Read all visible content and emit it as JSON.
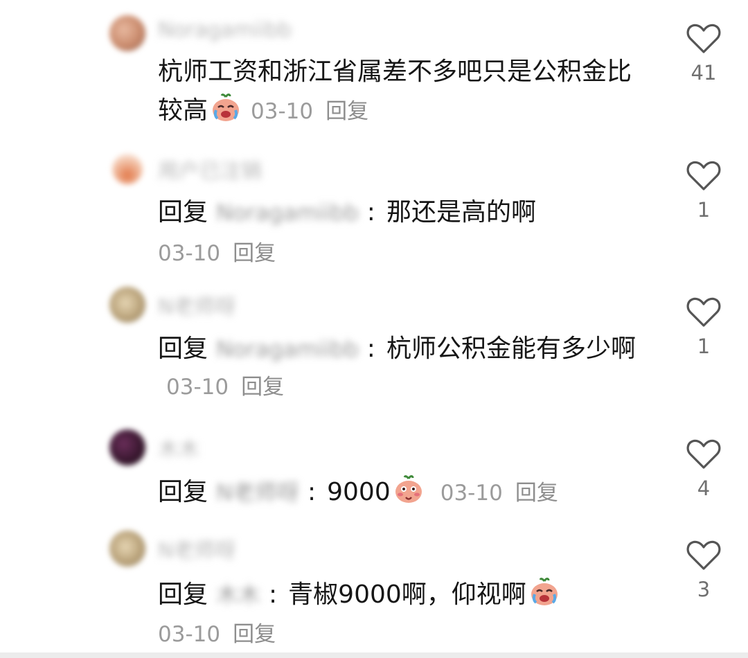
{
  "comments": [
    {
      "username": "Noragamiibb",
      "avatar_color": "#c98a6c",
      "text": "杭师工资和浙江省属差不多吧只是公积金比较高",
      "emoji": "crying-emoji",
      "date": "03-10",
      "reply_label": "回复",
      "likes": "41"
    },
    {
      "username": "用户已注销",
      "avatar_color": "#d9845c",
      "reply_prefix": "回复",
      "mention": "Noragamiibb",
      "text": "那还是高的啊",
      "date": "03-10",
      "reply_label": "回复",
      "likes": "1"
    },
    {
      "username": "N老师呀",
      "avatar_color": "#b9a27a",
      "reply_prefix": "回复",
      "mention": "Noragamiibb",
      "text": "杭师公积金能有多少啊",
      "date": "03-10",
      "reply_label": "回复",
      "likes": "1"
    },
    {
      "username": "木木",
      "avatar_color": "#3a1830",
      "reply_prefix": "回复",
      "mention": "N老师呀",
      "text": "9000",
      "emoji": "shy-emoji",
      "date": "03-10",
      "reply_label": "回复",
      "likes": "4"
    },
    {
      "username": "N老师呀",
      "avatar_color": "#b9a27a",
      "reply_prefix": "回复",
      "mention": "木木",
      "text": "青椒9000啊，仰视啊",
      "emoji": "crying-emoji",
      "date": "03-10",
      "reply_label": "回复",
      "likes": "3"
    }
  ],
  "icons": {
    "like": "heart-outline-icon"
  },
  "colors": {
    "text": "#161616",
    "meta": "#9b9b9b",
    "like_count": "#707070",
    "heart_stroke": "#555555"
  }
}
